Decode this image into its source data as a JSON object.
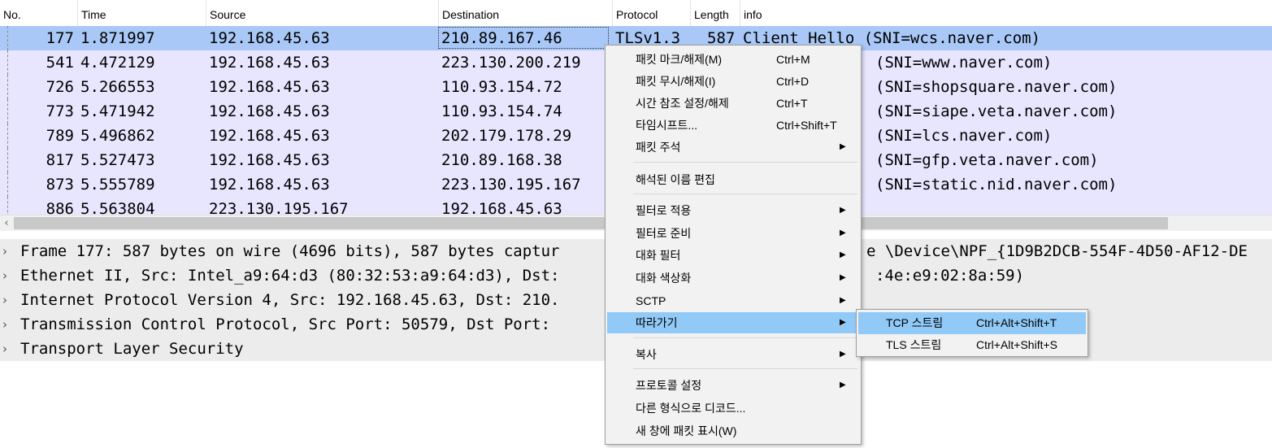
{
  "columns": [
    "No.",
    "Time",
    "Source",
    "Destination",
    "Protocol",
    "Length",
    "info"
  ],
  "packets": [
    {
      "no": "177",
      "time": "1.871997",
      "source": "192.168.45.63",
      "destination": "210.89.167.46",
      "protocol": "TLSv1.3",
      "length": "587",
      "info": "Client Hello (SNI=wcs.naver.com)",
      "selected": true
    },
    {
      "no": "541",
      "time": "4.472129",
      "source": "192.168.45.63",
      "destination": "223.130.200.219",
      "protocol": "",
      "length": "",
      "info": "(SNI=www.naver.com)"
    },
    {
      "no": "726",
      "time": "5.266553",
      "source": "192.168.45.63",
      "destination": "110.93.154.72",
      "protocol": "",
      "length": "",
      "info": "(SNI=shopsquare.naver.com)"
    },
    {
      "no": "773",
      "time": "5.471942",
      "source": "192.168.45.63",
      "destination": "110.93.154.74",
      "protocol": "",
      "length": "",
      "info": "(SNI=siape.veta.naver.com)"
    },
    {
      "no": "789",
      "time": "5.496862",
      "source": "192.168.45.63",
      "destination": "202.179.178.29",
      "protocol": "",
      "length": "",
      "info": "(SNI=lcs.naver.com)"
    },
    {
      "no": "817",
      "time": "5.527473",
      "source": "192.168.45.63",
      "destination": "210.89.168.38",
      "protocol": "",
      "length": "",
      "info": "(SNI=gfp.veta.naver.com)"
    },
    {
      "no": "873",
      "time": "5.555789",
      "source": "192.168.45.63",
      "destination": "223.130.195.167",
      "protocol": "",
      "length": "",
      "info": "(SNI=static.nid.naver.com)"
    },
    {
      "no": "886",
      "time": "5.563804",
      "source": "223.130.195.167",
      "destination": "192.168.45.63",
      "protocol": "",
      "length": "",
      "info": ""
    }
  ],
  "details": [
    {
      "text": "Frame 177: 587 bytes on wire (4696 bits), 587 bytes captur",
      "tail": "e \\Device\\NPF_{1D9B2DCB-554F-4D50-AF12-DE"
    },
    {
      "text": "Ethernet II, Src: Intel_a9:64:d3 (80:32:53:a9:64:d3), Dst:",
      "tail": ":4e:e9:02:8a:59)"
    },
    {
      "text": "Internet Protocol Version 4, Src: 192.168.45.63, Dst: 210.",
      "tail": ""
    },
    {
      "text": "Transmission Control Protocol, Src Port: 50579, Dst Port: ",
      "tail": ""
    },
    {
      "text": "Transport Layer Security",
      "tail": ""
    }
  ],
  "context_menu": {
    "items": [
      {
        "label": "패킷 마크/해제(M)",
        "shortcut": "Ctrl+M",
        "submenu": false
      },
      {
        "label": "패킷 무시/해제(I)",
        "shortcut": "Ctrl+D",
        "submenu": false
      },
      {
        "label": "시간 참조 설정/해제",
        "shortcut": "Ctrl+T",
        "submenu": false
      },
      {
        "label": "타임시프트...",
        "shortcut": "Ctrl+Shift+T",
        "submenu": false
      },
      {
        "label": "패킷 주석",
        "shortcut": "",
        "submenu": true
      },
      {
        "label": "해석된 이름 편집",
        "shortcut": "",
        "submenu": false
      },
      {
        "label": "필터로 적용",
        "shortcut": "",
        "submenu": true
      },
      {
        "label": "필터로 준비",
        "shortcut": "",
        "submenu": true
      },
      {
        "label": "대화 필터",
        "shortcut": "",
        "submenu": true
      },
      {
        "label": "대화 색상화",
        "shortcut": "",
        "submenu": true
      },
      {
        "label": "SCTP",
        "shortcut": "",
        "submenu": true
      },
      {
        "label": "따라가기",
        "shortcut": "",
        "submenu": true,
        "highlighted": true
      },
      {
        "label": "복사",
        "shortcut": "",
        "submenu": true
      },
      {
        "label": "프로토콜 설정",
        "shortcut": "",
        "submenu": true
      },
      {
        "label": "다른 형식으로 디코드...",
        "shortcut": "",
        "submenu": false
      },
      {
        "label": "새 창에 패킷 표시(W)",
        "shortcut": "",
        "submenu": false
      }
    ]
  },
  "follow_submenu": [
    {
      "label": "TCP 스트림",
      "shortcut": "Ctrl+Alt+Shift+T",
      "highlighted": true
    },
    {
      "label": "TLS 스트림",
      "shortcut": "Ctrl+Alt+Shift+S"
    }
  ],
  "colors": {
    "row_bg": "#e7e6fe",
    "selected_row_bg": "#a9c8f7",
    "menu_highlight": "#91c9f7",
    "detail_bg": "#ececec"
  },
  "icons": {
    "submenu_arrow": "▶",
    "expand_arrow": "›",
    "scroll_left": "‹"
  }
}
